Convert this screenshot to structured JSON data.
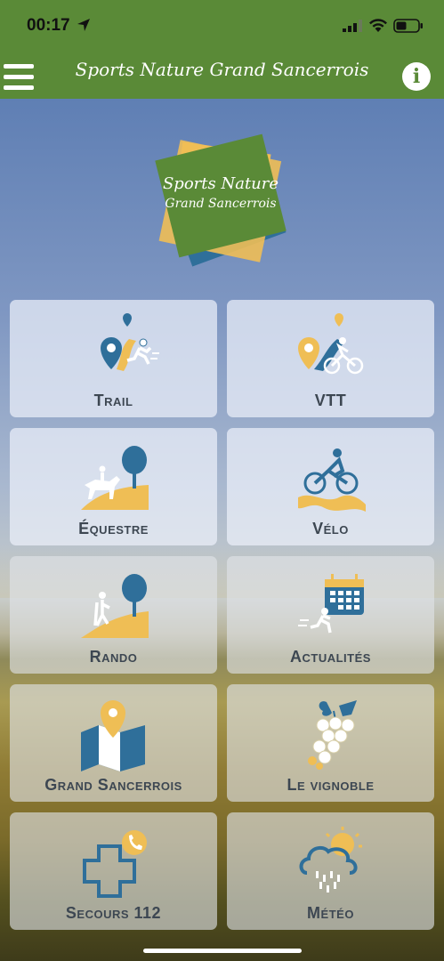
{
  "status_bar": {
    "time": "00:17"
  },
  "header": {
    "title": "Sports Nature Grand Sancerrois",
    "info_label": "i"
  },
  "logo": {
    "line1": "Sports Nature",
    "line2": "Grand Sancerrois"
  },
  "colors": {
    "header_green": "#5a8a37",
    "accent_blue": "#2f6f9a",
    "accent_yellow": "#efbe55"
  },
  "tiles": [
    {
      "label": "Trail",
      "icon": "trail-runner-icon"
    },
    {
      "label": "VTT",
      "icon": "mountain-bike-icon"
    },
    {
      "label": "Équestre",
      "icon": "horse-rider-icon"
    },
    {
      "label": "Vélo",
      "icon": "cyclist-icon"
    },
    {
      "label": "Rando",
      "icon": "hiker-icon"
    },
    {
      "label": "Actualités",
      "icon": "calendar-runner-icon"
    },
    {
      "label": "Grand Sancerrois",
      "icon": "map-pin-icon"
    },
    {
      "label": "Le vignoble",
      "icon": "grapes-icon"
    },
    {
      "label": "Secours 112",
      "icon": "medical-cross-phone-icon"
    },
    {
      "label": "Météo",
      "icon": "weather-cloud-icon"
    }
  ]
}
